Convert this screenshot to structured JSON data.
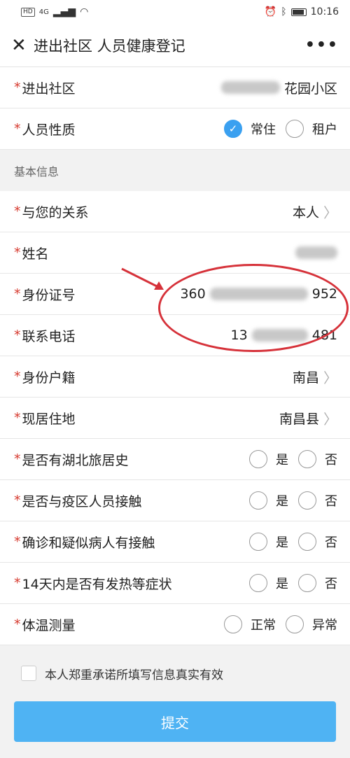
{
  "status_bar": {
    "hd": "HD",
    "network": "4G",
    "time": "10:16"
  },
  "nav": {
    "title": "进出社区 人员健康登记",
    "more": "•••"
  },
  "fields": {
    "community": {
      "label": "进出社区",
      "value_suffix": "花园小区"
    },
    "person_type": {
      "label": "人员性质",
      "opt1": "常住",
      "opt2": "租户"
    },
    "section_basic": "基本信息",
    "relation": {
      "label": "与您的关系",
      "value": "本人"
    },
    "name": {
      "label": "姓名"
    },
    "id_number": {
      "label": "身份证号",
      "prefix": "360",
      "suffix": "952"
    },
    "phone": {
      "label": "联系电话",
      "prefix": "13",
      "suffix": "481"
    },
    "household": {
      "label": "身份户籍",
      "value": "南昌"
    },
    "residence": {
      "label": "现居住地",
      "value": "南昌县"
    },
    "q1": {
      "label": "是否有湖北旅居史",
      "yes": "是",
      "no": "否"
    },
    "q2": {
      "label": "是否与疫区人员接触",
      "yes": "是",
      "no": "否"
    },
    "q3": {
      "label": "确诊和疑似病人有接触",
      "yes": "是",
      "no": "否"
    },
    "q4": {
      "label": "14天内是否有发热等症状",
      "yes": "是",
      "no": "否"
    },
    "temp": {
      "label": "体温测量",
      "normal": "正常",
      "abnormal": "异常"
    }
  },
  "agreement": "本人郑重承诺所填写信息真实有效",
  "submit_label": "提交",
  "colors": {
    "accent": "#4fb3f3",
    "required_star": "#d63a2f",
    "annotation": "#d6323a"
  }
}
